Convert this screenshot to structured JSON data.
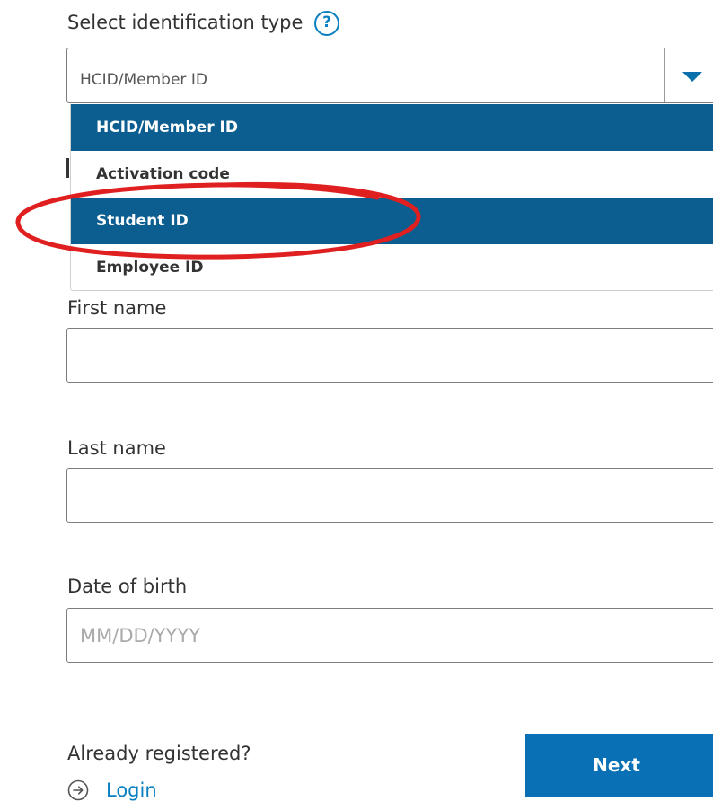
{
  "id_type": {
    "label": "Select identification type",
    "help_glyph": "?",
    "selected_value": "HCID/Member ID",
    "options": [
      {
        "label": "HCID/Member ID"
      },
      {
        "label": "Activation code"
      },
      {
        "label": "Student ID"
      },
      {
        "label": "Employee ID"
      }
    ]
  },
  "first_name": {
    "label": "First name",
    "value": "",
    "placeholder": ""
  },
  "last_name": {
    "label": "Last name",
    "value": "",
    "placeholder": ""
  },
  "date_of_birth": {
    "label": "Date of birth",
    "value": "",
    "placeholder": "MM/DD/YYYY"
  },
  "footer": {
    "already_registered": "Already registered?",
    "login_label": "Login",
    "next_label": "Next"
  },
  "icons": {
    "help": "help-circle-icon",
    "caret": "caret-down-icon",
    "login": "arrow-right-circle-icon"
  },
  "colors": {
    "accent": "#0a7fc2",
    "highlight": "#0b5e8f",
    "button": "#0a70b5",
    "annotation": "#e02020"
  }
}
